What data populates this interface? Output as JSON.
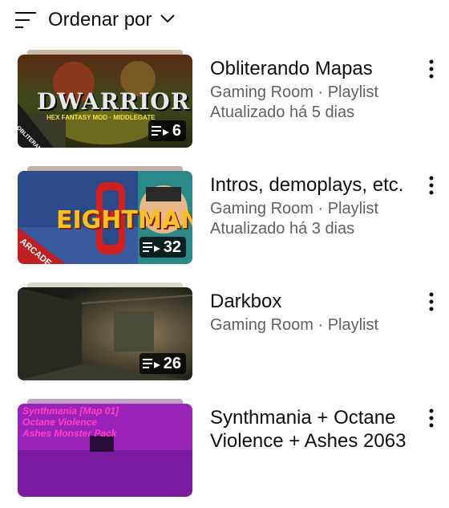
{
  "sort": {
    "label": "Ordenar por"
  },
  "playlists": [
    {
      "title": "Obliterando Mapas",
      "channel_type": "Gaming Room · Playlist",
      "updated": "Atualizado há 5 dias",
      "count": "6",
      "thumb_text": {
        "main": "DWARRIOR",
        "sub": "HEX FANTASY MOD · MIDDLEGATE",
        "tag": "OBLITERANDO MAPAS"
      }
    },
    {
      "title": "Intros, demoplays, etc.",
      "channel_type": "Gaming Room · Playlist",
      "updated": "Atualizado há 3 dias",
      "count": "32",
      "thumb_text": {
        "main": "EIGHTMAN",
        "tag": "ARCADE"
      }
    },
    {
      "title": "Darkbox",
      "channel_type": "Gaming Room · Playlist",
      "count": "26"
    },
    {
      "title": "Synthmania + Octane Violence + Ashes 2063",
      "thumb_text": {
        "line1": "Synthmania [Map 01]",
        "line2": "Octane Violence",
        "line3": "Ashes Monster Pack"
      }
    }
  ]
}
